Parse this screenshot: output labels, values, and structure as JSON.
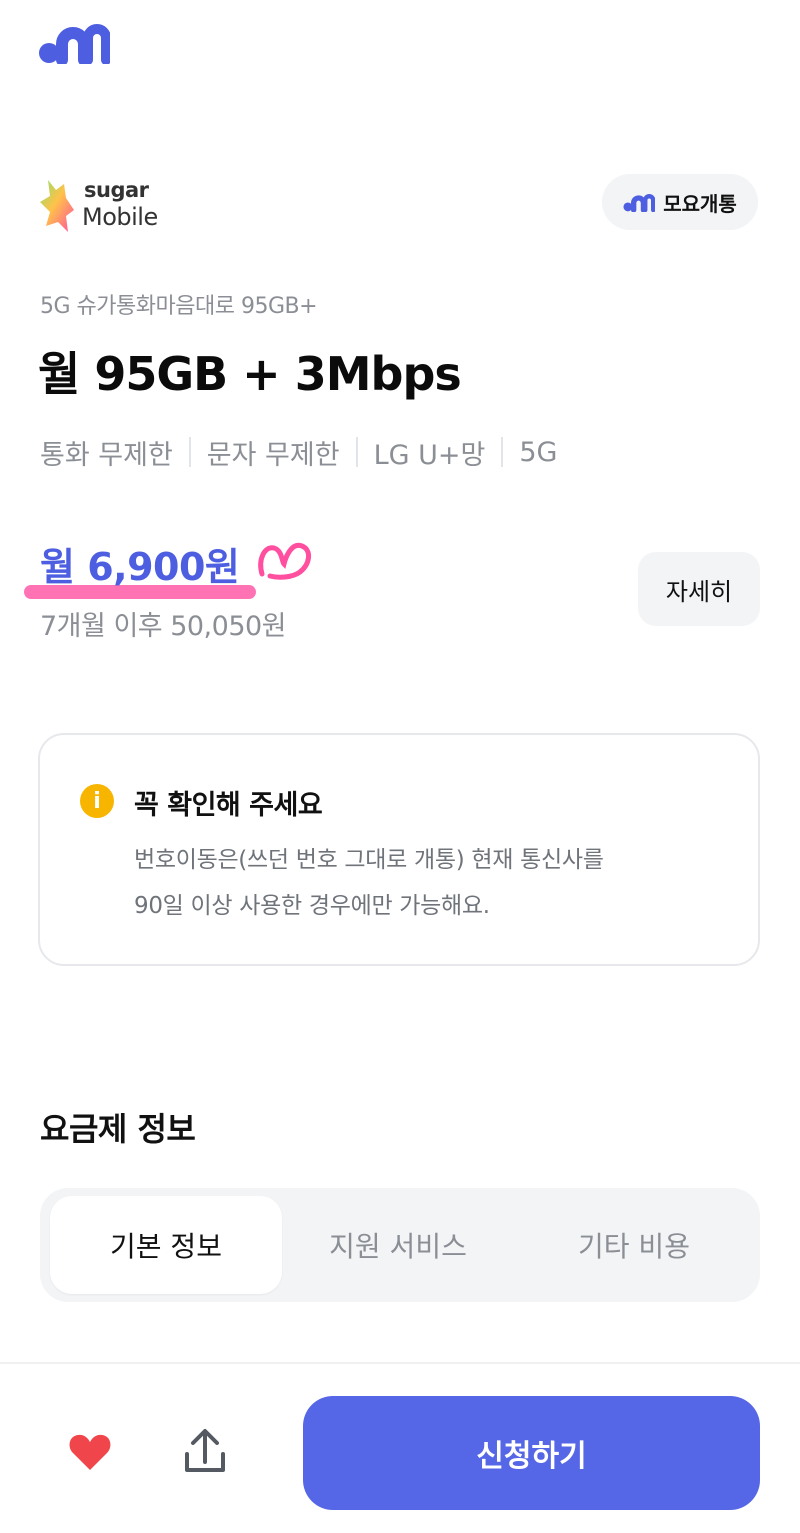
{
  "header": {
    "logo_icon": "moyo-logo-icon"
  },
  "carrier": {
    "line1": "sugar",
    "line2": "Mobile",
    "logo_icon": "sugar-mobile-logo-icon"
  },
  "badge": {
    "label": "모요개통",
    "icon": "moyo-logo-icon"
  },
  "plan": {
    "name": "5G 슈가통화마음대로 95GB+",
    "title": "월 95GB + 3Mbps",
    "features": [
      "통화 무제한",
      "문자 무제한",
      "LG U+망",
      "5G"
    ]
  },
  "price": {
    "main": "월 6,900원",
    "after": "7개월 이후 50,050원",
    "details_label": "자세히"
  },
  "notice": {
    "icon": "info-icon",
    "icon_glyph": "i",
    "title": "꼭 확인해 주세요",
    "line1": "번호이동은(쓰던 번호 그대로 개통) 현재 통신사를",
    "line2": "90일 이상 사용한 경우에만 가능해요."
  },
  "section": {
    "title": "요금제 정보"
  },
  "tabs": [
    {
      "label": "기본 정보",
      "selected": true
    },
    {
      "label": "지원 서비스",
      "selected": false
    },
    {
      "label": "기타 비용",
      "selected": false
    }
  ],
  "footer": {
    "apply_label": "신청하기",
    "heart_icon": "heart-icon",
    "share_icon": "share-icon"
  },
  "colors": {
    "accent": "#5566e6",
    "price": "#4d5fe0",
    "highlight": "#ff5aa8",
    "heart": "#f0454b",
    "notice_icon": "#f7b500"
  }
}
